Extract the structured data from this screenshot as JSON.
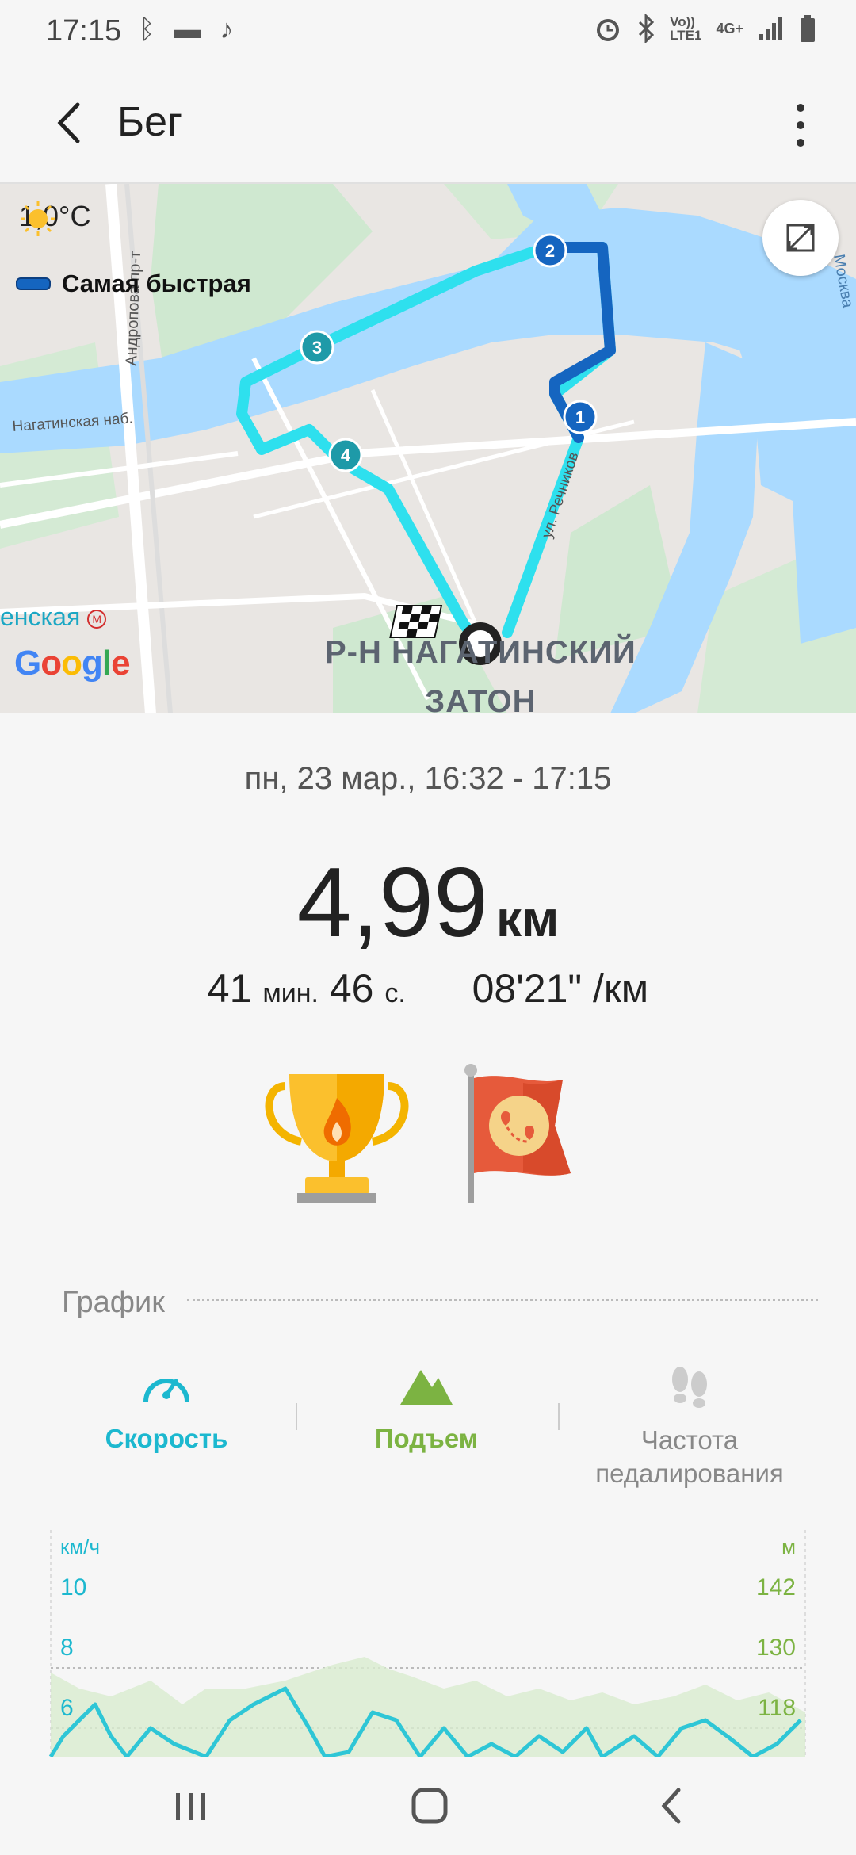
{
  "status_bar": {
    "time": "17:15",
    "right_icons": [
      "alarm-icon",
      "bluetooth-icon",
      "volte-icon",
      "4g-icon",
      "signal-icon",
      "battery-icon"
    ],
    "volte_label": "Vo))\nLTE1",
    "network_label": "4G+"
  },
  "app_bar": {
    "title": "Бег"
  },
  "map": {
    "weather_temp": "1,0°C",
    "legend_label": "Самая быстрая",
    "district_line1": "Р-Н НАГАТИНСКИЙ",
    "district_line2": "ЗАТОН",
    "metro_label": "енская",
    "road_andropov": "Андропова пр-т",
    "road_nagatinsk": "Нагатинская наб.",
    "road_rechnikov": "ул. Речников",
    "river_label": "Москва",
    "google": "Google",
    "markers": [
      "1",
      "2",
      "3",
      "4"
    ],
    "colors": {
      "route": "#2ee0ee",
      "fastest": "#1565c0",
      "water": "#aadaff",
      "park": "#c8e6c9"
    }
  },
  "workout": {
    "date_range": "пн, 23 мар., 16:32 - 17:15",
    "distance_value": "4,99",
    "distance_unit": "км",
    "duration_min": "41",
    "duration_min_unit": "мин.",
    "duration_sec": "46",
    "duration_sec_unit": "с.",
    "pace": "08'21\" /км",
    "achievements": [
      "trophy-icon",
      "route-flag-icon"
    ]
  },
  "graph": {
    "header": "График",
    "tabs": [
      {
        "label": "Скорость",
        "color": "#1cb8cf"
      },
      {
        "label": "Подъем",
        "color": "#7cb342"
      },
      {
        "label": "Частота\nпедалирования",
        "color": "#888888"
      }
    ],
    "left_axis_unit": "км/ч",
    "right_axis_unit": "м",
    "left_ticks": [
      "10",
      "8",
      "6"
    ],
    "right_ticks": [
      "142",
      "130",
      "118"
    ]
  }
}
